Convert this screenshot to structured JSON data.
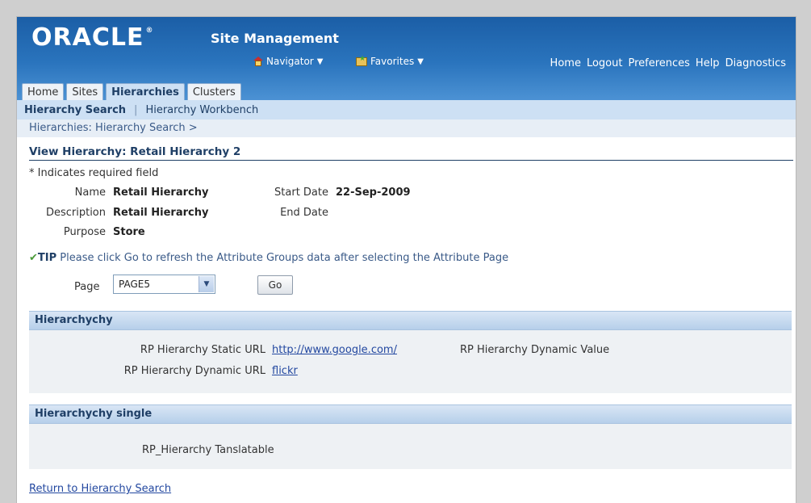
{
  "header": {
    "logo": "ORACLE",
    "logo_mark": "®",
    "app_title": "Site Management",
    "navigator": "Navigator",
    "favorites": "Favorites",
    "global_links": [
      "Home",
      "Logout",
      "Preferences",
      "Help",
      "Diagnostics"
    ]
  },
  "tabs": [
    "Home",
    "Sites",
    "Hierarchies",
    "Clusters"
  ],
  "active_tab": "Hierarchies",
  "subtabs": {
    "active": "Hierarchy Search",
    "separator": "|",
    "other": "Hierarchy Workbench"
  },
  "breadcrumb": "Hierarchies: Hierarchy Search >",
  "page_title": "View Hierarchy: Retail Hierarchy 2",
  "required_note": "* Indicates required field",
  "fields": {
    "name_label": "Name",
    "name_value": "Retail Hierarchy",
    "description_label": "Description",
    "description_value": "Retail Hierarchy",
    "purpose_label": "Purpose",
    "purpose_value": "Store",
    "start_date_label": "Start Date",
    "start_date_value": "22-Sep-2009",
    "end_date_label": "End Date"
  },
  "tip": {
    "label": "TIP",
    "text": " Please click Go to refresh the Attribute Groups data after selecting the Attribute Page"
  },
  "page_select": {
    "label": "Page",
    "value": "PAGE5"
  },
  "go_button": "Go",
  "section1": {
    "header": "Hierarchychy",
    "static_url_label": "RP Hierarchy Static URL",
    "static_url_value": "http://www.google.com/",
    "dynamic_value_label": "RP Hierarchy Dynamic Value",
    "dynamic_url_label": "RP Hierarchy Dynamic URL",
    "dynamic_url_value": "flickr"
  },
  "section2": {
    "header": "Hierarchychy single",
    "translatable_label": "RP_Hierarchy Tanslatable"
  },
  "return_link": "Return to Hierarchy Search",
  "colors": {
    "header_blue": "#2a74bd",
    "tab_active": "#cde0f4",
    "link": "#2348a0",
    "title_blue": "#1f3f66"
  }
}
